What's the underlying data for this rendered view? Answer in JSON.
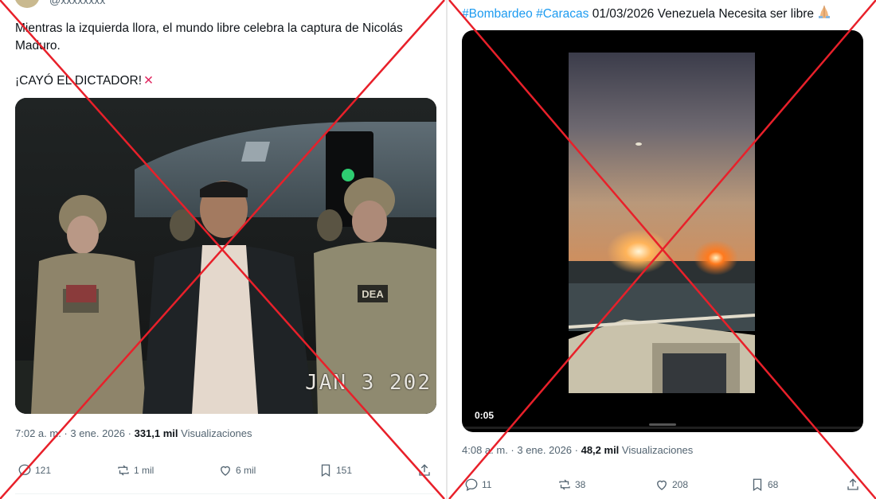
{
  "left_post": {
    "handle": "@xxxxxxxx",
    "text_line1": "Mientras la izquierda llora, el mundo libre celebra la captura de Nicolás Maduro.",
    "text_line2": "¡CAYÓ EL DICTADOR!",
    "photo_stamp": "JAN 3 202",
    "meta": {
      "time": "7:02 a. m. · 3 ene. 2026 · ",
      "views": "331,1 mil",
      "views_label": " Visualizaciones"
    },
    "actions": {
      "replies": "121",
      "reposts": "1 mil",
      "likes": "6 mil",
      "bookmarks": "151"
    }
  },
  "right_post": {
    "hashtag1": "#Bombardeo",
    "hashtag2": "#Caracas",
    "text": " 01/03/2026 Venezuela Necesita ser libre ",
    "video_time": "0:05",
    "video_progress": 0,
    "meta": {
      "time": "4:08 a. m. · 3 ene. 2026 · ",
      "views": "48,2 mil",
      "views_label": " Visualizaciones"
    },
    "actions": {
      "replies": "11",
      "reposts": "38",
      "likes": "208",
      "bookmarks": "68"
    }
  },
  "colors": {
    "cross": "#e8202a",
    "hashtag": "#1d9bf0",
    "muted": "#536471"
  },
  "icons": [
    "reply-icon",
    "repost-icon",
    "like-icon",
    "bookmark-icon",
    "share-icon",
    "pray-emoji-icon",
    "red-x-emoji-icon"
  ]
}
